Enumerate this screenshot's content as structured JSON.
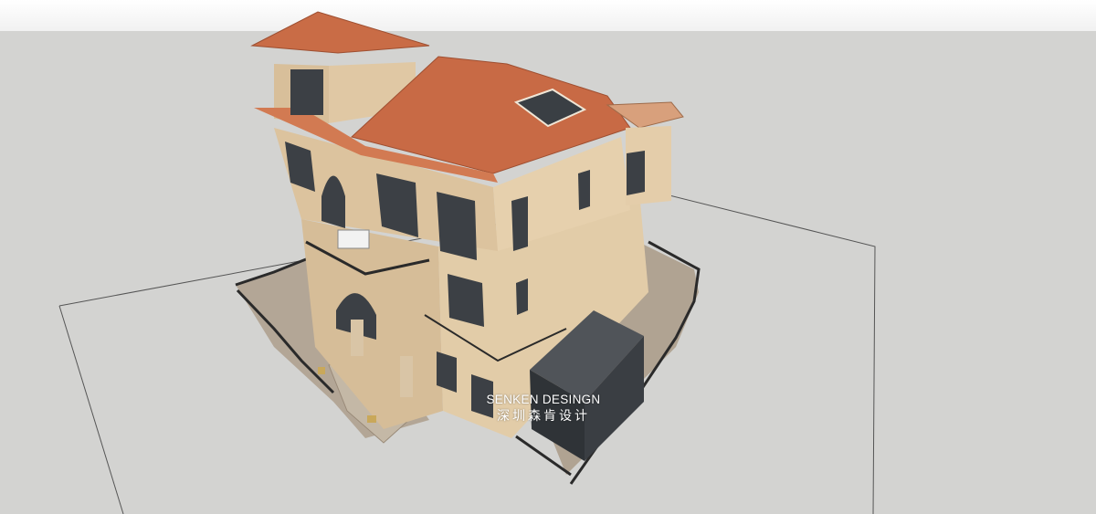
{
  "watermark": {
    "line1": "SENKEN DESINGN",
    "line2": "深圳森肯设计"
  },
  "colors": {
    "sky": "#ffffff",
    "ground": "#d3d3d1",
    "roof_tile": "#c86a45",
    "wall": "#e0c9a6",
    "stone": "#cdb596",
    "paving": "#b3a696",
    "glass": "#2f3337",
    "railing": "#2a2a2a"
  }
}
